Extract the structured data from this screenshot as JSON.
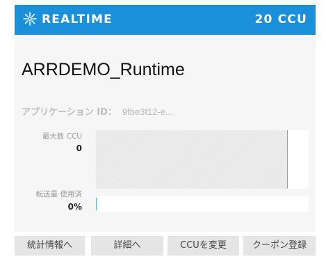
{
  "header": {
    "title": "REALTIME",
    "ccu": "20 CCU",
    "icon": "sparkle-icon",
    "color": "#1a90db"
  },
  "app": {
    "name": "ARRDEMO_Runtime",
    "id_label": "アプリケーション ID：",
    "id_value": "9fbe3f12-e..."
  },
  "metrics": {
    "max_ccu_label": "最大数 CCU",
    "max_ccu_value": "0",
    "max_ccu_fill_fraction": 0.9,
    "transfer_label": "転送量 使用済",
    "transfer_value": "0%",
    "transfer_fraction": 0
  },
  "buttons": {
    "stats": "統計情報へ",
    "details": "詳細へ",
    "change_ccu": "CCUを変更",
    "coupon": "クーポン登録"
  }
}
